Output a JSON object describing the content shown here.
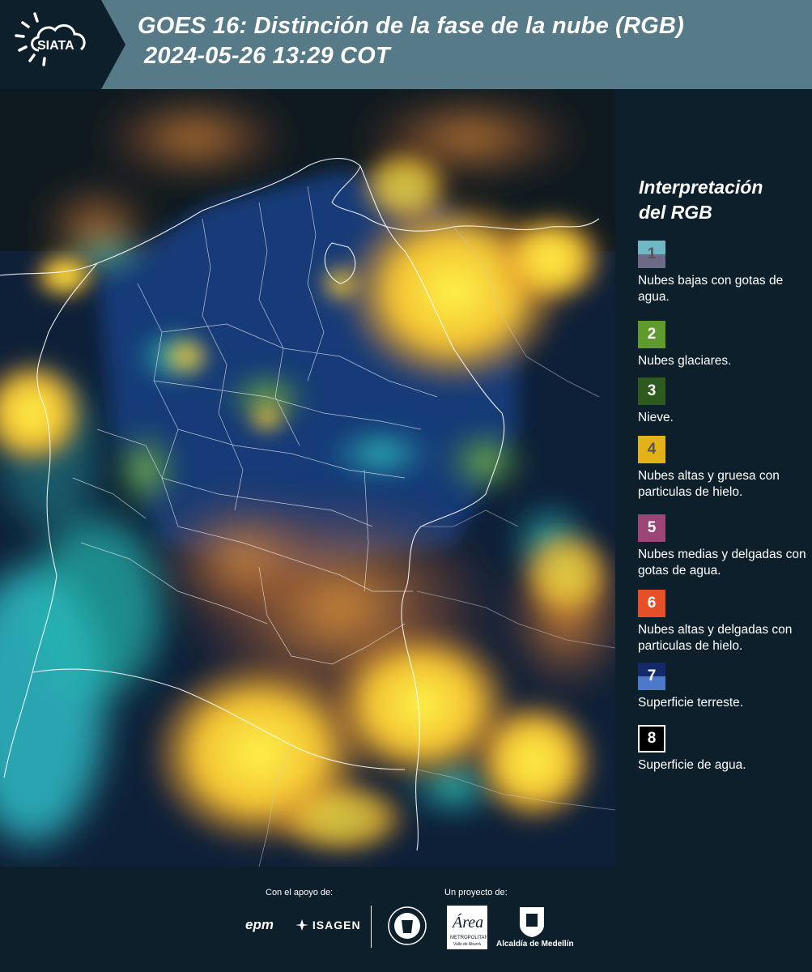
{
  "header": {
    "logo_text": "SIATA",
    "title_line1": "GOES 16: Distinción de la fase de la nube (RGB)",
    "title_line2": "2024-05-26 13:29 COT"
  },
  "legend": {
    "title_line1": "Interpretación",
    "title_line2": "del RGB",
    "items": [
      {
        "num": "1",
        "label": "Nubes bajas con gotas de agua.",
        "color_top": "#6fb7c4",
        "color_bottom": "#6c6a86",
        "num_color": "#555"
      },
      {
        "num": "2",
        "label": "Nubes glaciares.",
        "color_top": "#5e9a2e",
        "color_bottom": "#5e9a2e",
        "num_color": "#ffffff"
      },
      {
        "num": "3",
        "label": "Nieve.",
        "color_top": "#2f5a1d",
        "color_bottom": "#2f5a1d",
        "num_color": "#ffffff"
      },
      {
        "num": "4",
        "label": "Nubes altas y gruesa con particulas de hielo.",
        "color_top": "#e3b11a",
        "color_bottom": "#e3b11a",
        "num_color": "#555"
      },
      {
        "num": "5",
        "label": "Nubes medias y delgadas con gotas de agua.",
        "color_top": "#9c4577",
        "color_bottom": "#9c4577",
        "num_color": "#ffffff"
      },
      {
        "num": "6",
        "label": "Nubes altas y delgadas con particulas de hielo.",
        "color_top": "#e55028",
        "color_bottom": "#e55028",
        "num_color": "#ffffff"
      },
      {
        "num": "7",
        "label": "Superficie terreste.",
        "color_top": "#13296a",
        "color_bottom": "#4d79c9",
        "num_color": "#ffffff"
      },
      {
        "num": "8",
        "label": "Superficie de agua.",
        "color_top": "#000000",
        "color_bottom": "#000000",
        "num_color": "#ffffff"
      }
    ]
  },
  "footer": {
    "support_label": "Con el apoyo de:",
    "project_label": "Un proyecto de:",
    "sponsor1": "epm",
    "sponsor2": "ISAGEN",
    "partner1": "Área Metropolitana",
    "partner1_sub": "Valle de Aburrá",
    "partner2": "Alcaldía de Medellín"
  }
}
